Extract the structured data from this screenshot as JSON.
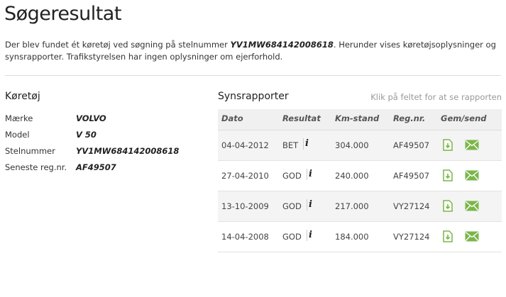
{
  "page": {
    "title": "Søgeresultat",
    "intro_before": "Der blev fundet ét køretøj ved søgning på stelnummer ",
    "intro_vin": "YV1MW684142008618",
    "intro_after": ". Herunder vises køretøjsoplysninger og synsrapporter. Trafikstyrelsen har ingen oplysninger om ejerforhold."
  },
  "vehicle": {
    "heading": "Køretøj",
    "rows": [
      {
        "label": "Mærke",
        "value": "VOLVO"
      },
      {
        "label": "Model",
        "value": "V 50"
      },
      {
        "label": "Stelnummer",
        "value": "YV1MW684142008618"
      },
      {
        "label": "Seneste reg.nr.",
        "value": "AF49507"
      }
    ]
  },
  "reports": {
    "heading": "Synsrapporter",
    "hint": "Klik på feltet for at se rapporten",
    "columns": {
      "date": "Dato",
      "result": "Resultat",
      "km": "Km-stand",
      "reg": "Reg.nr.",
      "actions": "Gem/send"
    },
    "rows": [
      {
        "date": "04-04-2012",
        "result": "BET",
        "km": "304.000",
        "reg": "AF49507"
      },
      {
        "date": "27-04-2010",
        "result": "GOD",
        "km": "240.000",
        "reg": "AF49507"
      },
      {
        "date": "13-10-2009",
        "result": "GOD",
        "km": "217.000",
        "reg": "VY27124"
      },
      {
        "date": "14-04-2008",
        "result": "GOD",
        "km": "184.000",
        "reg": "VY27124"
      }
    ],
    "info_glyph": "i",
    "icons": {
      "save": "save-document-icon",
      "send": "envelope-icon"
    },
    "colors": {
      "icon_green": "#7ab648",
      "header_bg": "#f0f0f0",
      "row_alt_bg": "#f4f4f4"
    }
  }
}
